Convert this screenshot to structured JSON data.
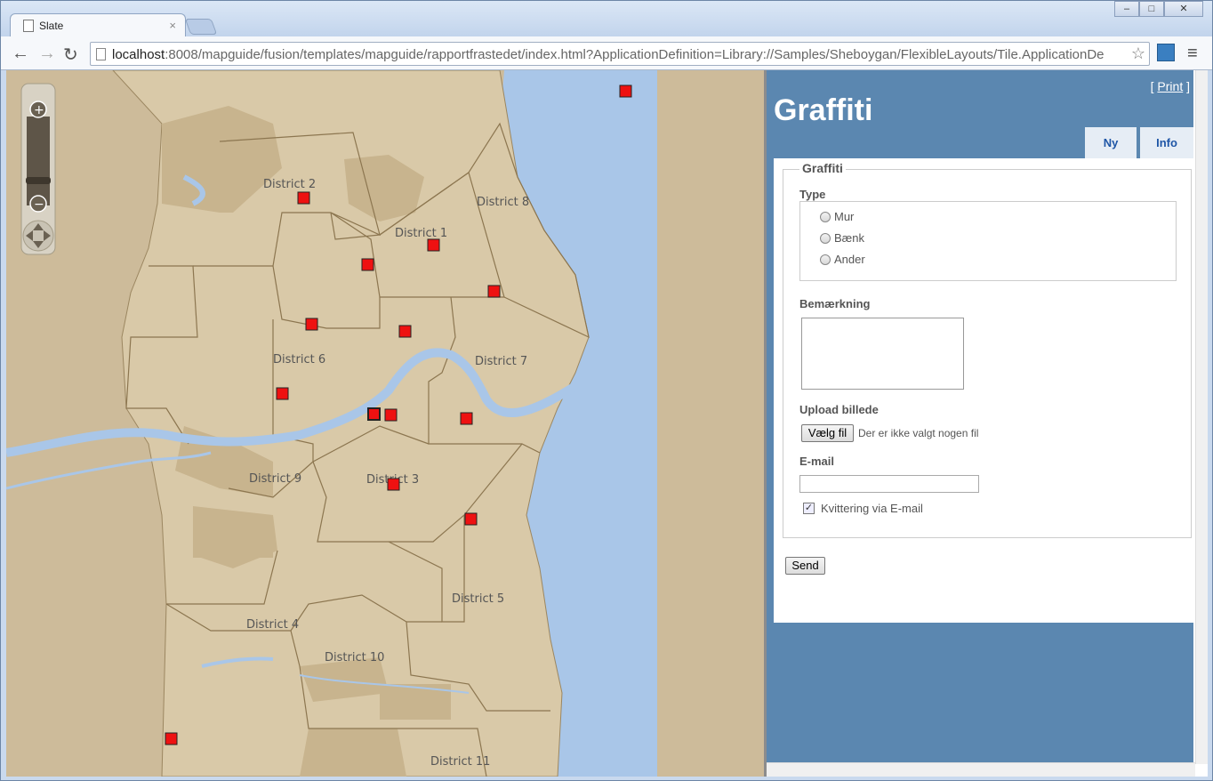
{
  "browser": {
    "tab_title": "Slate",
    "url_host": "localhost",
    "url_rest": ":8008/mapguide/fusion/templates/mapguide/rapportfrastedet/index.html?ApplicationDefinition=Library://Samples/Sheboygan/FlexibleLayouts/Tile.ApplicationDe",
    "tab_close": "×",
    "win_min": "–",
    "win_max": "□",
    "win_close": "✕"
  },
  "map": {
    "districts": [
      "District 2",
      "District 8",
      "District 1",
      "District 6",
      "District 7",
      "District 9",
      "District 3",
      "District 5",
      "District 4",
      "District 10",
      "District 11"
    ]
  },
  "panel": {
    "print_prefix": "[ ",
    "print_label": "Print",
    "print_suffix": " ]",
    "title": "Graffiti",
    "tabs": [
      "Ny",
      "Info"
    ],
    "form": {
      "legend": "Graffiti",
      "type_label": "Type",
      "type_options": [
        "Mur",
        "Bænk",
        "Ander"
      ],
      "remark_label": "Bemærkning",
      "upload_label": "Upload billede",
      "file_button": "Vælg fil",
      "file_status": "Der er ikke valgt nogen fil",
      "email_label": "E-mail",
      "receipt_label": "Kvittering via E-mail",
      "receipt_checked": true,
      "send_label": "Send"
    }
  },
  "colors": {
    "panel_bg": "#5b87b0",
    "water": "#a9c6e8",
    "land": "#d9c9a8",
    "marker": "#ee1111"
  }
}
